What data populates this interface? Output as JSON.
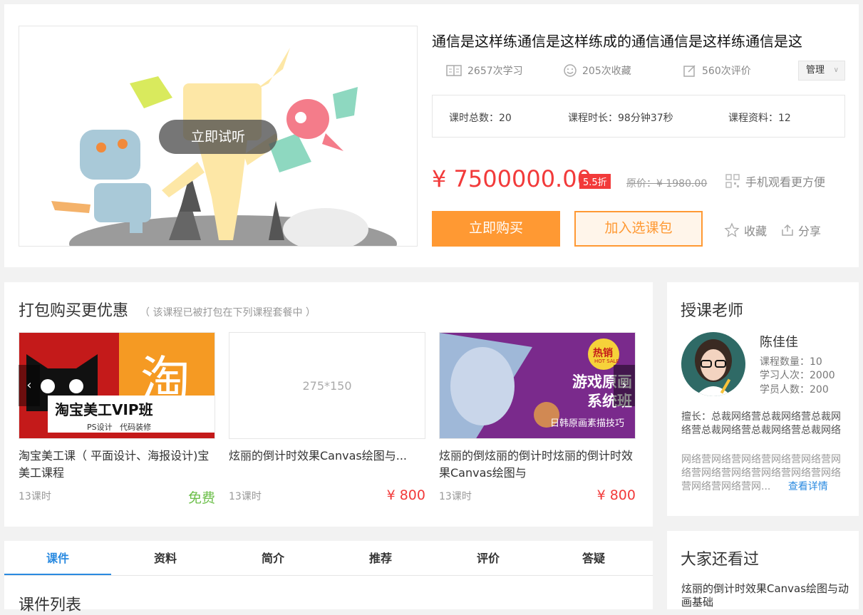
{
  "course": {
    "title": "通信是这样练通信是这样练成的通信通信是这样练通信是这",
    "trial_label": "立即试听",
    "stats": {
      "learned": "2657次学习",
      "favorites": "205次收藏",
      "reviews": "560次评价"
    },
    "manage_label": "管理",
    "info": {
      "lessons": "课时总数：20",
      "duration": "课程时长：98分钟37秒",
      "materials": "课程资料：12"
    },
    "price": "¥ 7500000.00",
    "discount": "5.5折",
    "original_price": "原价：¥ 1980.00",
    "mobile_label": "手机观看更方便",
    "buy_label": "立即购买",
    "add_package_label": "加入选课包",
    "favorite_label": "收藏",
    "share_label": "分享"
  },
  "bundle": {
    "title": "打包购买更优惠",
    "note": "（ 该课程已被打包在下列课程套餐中 ）",
    "courses": [
      {
        "banner_title": "淘宝美工VIP班",
        "banner_sub": "PS设计   代码装修",
        "name": "淘宝美工课（ 平面设计、海报设计)宝美工课程",
        "lessons": "13课时",
        "price": "免费",
        "price_color": "#6cbf4a"
      },
      {
        "placeholder": "275*150",
        "name": "炫丽的倒计时效果Canvas绘图与...",
        "lessons": "13课时",
        "price": "¥ 800",
        "price_color": "#f23a3a"
      },
      {
        "banner_title": "游戏原画\n系统班",
        "banner_hot": "热销",
        "banner_hot_sub": "HOT SALE",
        "banner_sub": "日韩原画素描技巧",
        "name": "炫丽的倒炫丽的倒计时炫丽的倒计时效果Canvas绘图与",
        "lessons": "13课时",
        "price": "¥ 800",
        "price_color": "#f23a3a"
      }
    ]
  },
  "teacher": {
    "title": "授课老师",
    "name": "陈佳佳",
    "course_count": "课程数量：10",
    "learn_count": "学习人次：2000",
    "student_count": "学员人数：200",
    "specialty": "擅长：总裁网络营总裁网络营总裁网络营总裁网络营总裁网络营总裁网络",
    "bio": "网络营网络营网络营网络营网络营网络营网络营网络营网络营网络营网络营网络营网络营网...",
    "detail_label": "查看详情"
  },
  "tabs": [
    "课件",
    "资料",
    "简介",
    "推荐",
    "评价",
    "答疑"
  ],
  "courseware_title": "课件列表",
  "also_watched": {
    "title": "大家还看过",
    "items": [
      "炫丽的倒计时效果Canvas绘图与动画基础"
    ]
  },
  "colors": {
    "accent": "#2a8ae0",
    "price": "#f23a3a",
    "buy": "#ff9933"
  }
}
